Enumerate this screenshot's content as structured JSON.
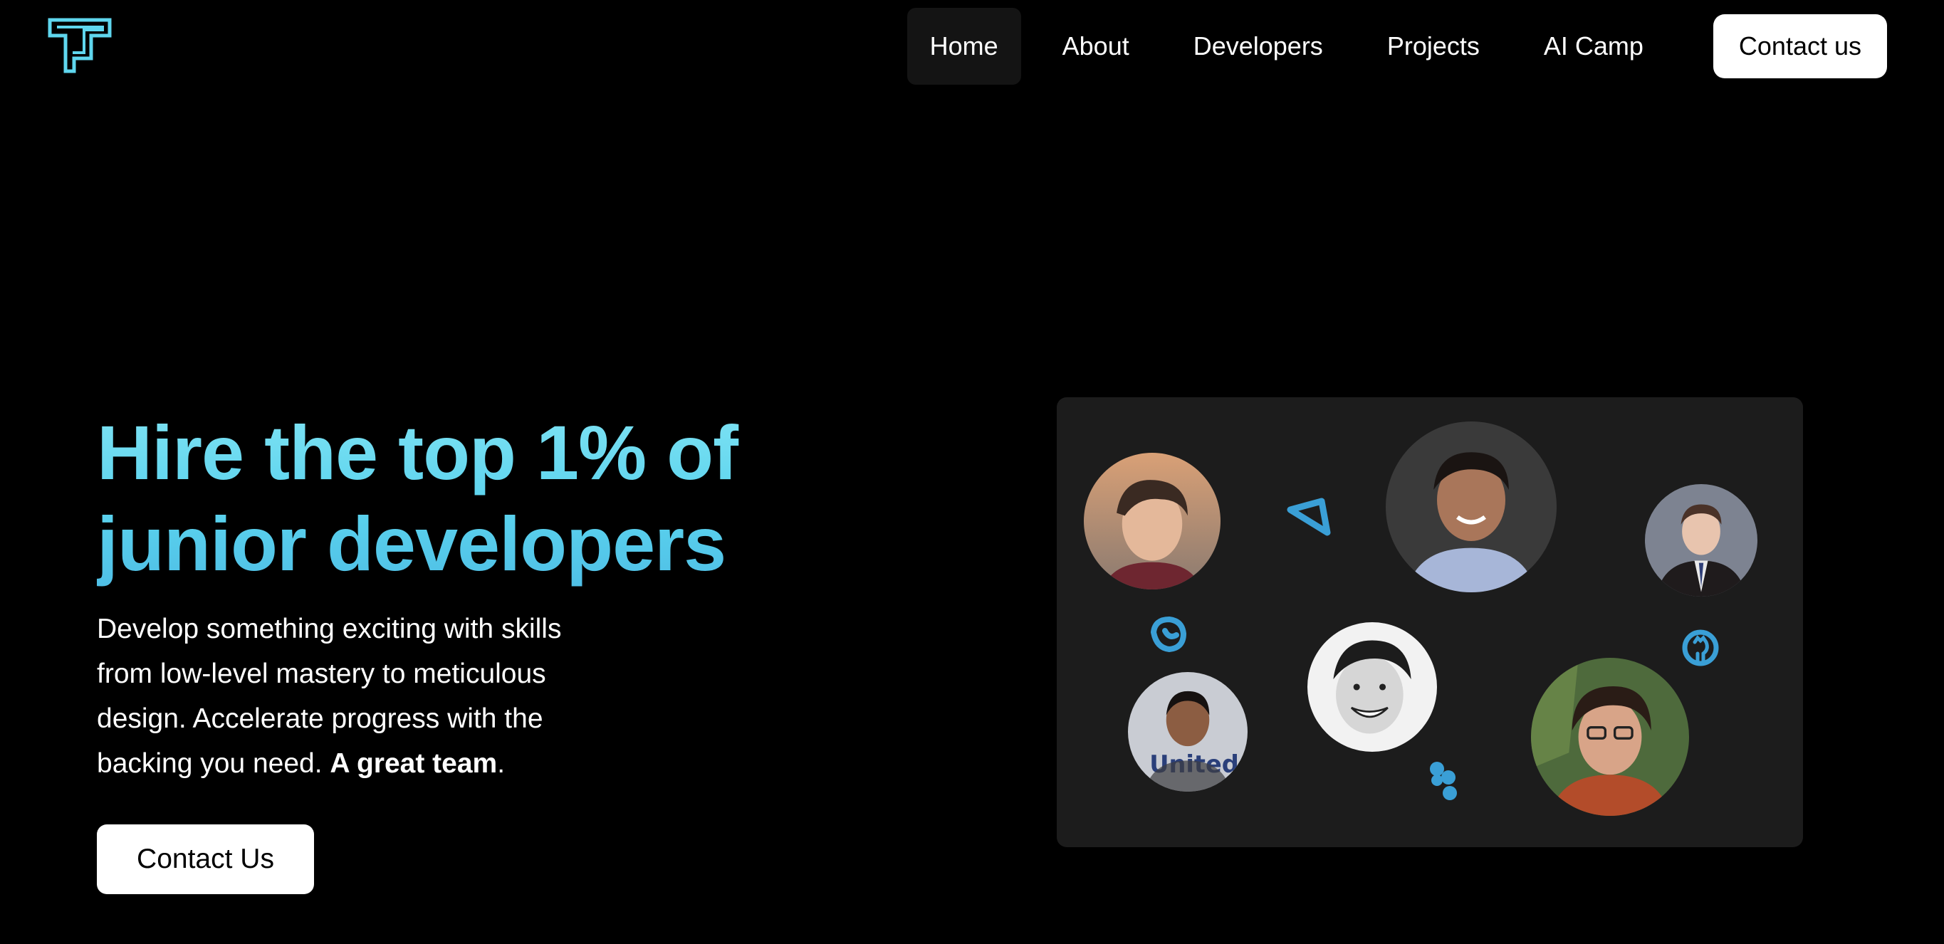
{
  "nav": {
    "items": [
      {
        "label": "Home",
        "active": true
      },
      {
        "label": "About"
      },
      {
        "label": "Developers"
      },
      {
        "label": "Projects"
      },
      {
        "label": "AI Camp"
      }
    ],
    "contact_label": "Contact us"
  },
  "hero": {
    "title": "Hire the top 1% of junior developers",
    "description": "Develop something exciting with skills from low-level mastery to meticulous design. Accelerate progress with the backing you need. ",
    "description_emphasis": "A great team",
    "description_end": ".",
    "button_label": "Contact Us"
  },
  "team_panel": {
    "avatars": [
      "avatar-1",
      "avatar-2",
      "avatar-3",
      "avatar-4",
      "avatar-5",
      "avatar-6"
    ],
    "tool_icons": [
      "prisma-icon",
      "vercel-icon",
      "github-icon",
      "figma-icon",
      "swift-icon"
    ]
  },
  "colors": {
    "background": "#000000",
    "accent": "#5bd3ee",
    "panel": "#1c1c1c",
    "icon_blue": "#3a9fd6"
  }
}
